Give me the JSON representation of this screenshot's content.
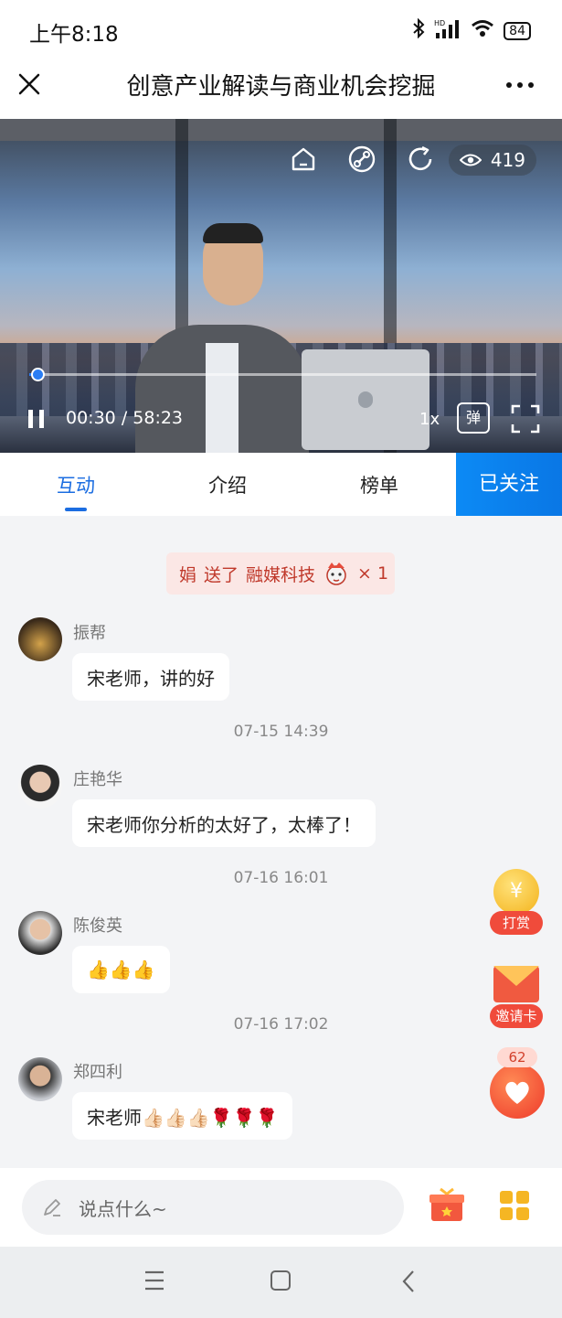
{
  "status_bar": {
    "time": "上午8:18",
    "signal": "HD",
    "battery": "84"
  },
  "header": {
    "title": "创意产业解读与商业机会挖掘"
  },
  "video": {
    "viewer_count": "419",
    "current_time": "00:30",
    "duration": "58:23",
    "time_separator": "/",
    "speed": "1x",
    "danmu_label": "弹",
    "progress_fraction": 0.009
  },
  "tabs": [
    {
      "label": "互动",
      "active": true
    },
    {
      "label": "介绍",
      "active": false
    },
    {
      "label": "榜单",
      "active": false
    }
  ],
  "follow_button": "已关注",
  "gift_banner": {
    "sender": "娟",
    "verb": "送了",
    "gift": "融媒科技",
    "count": "× 1"
  },
  "messages": [
    {
      "user": "振帮",
      "text": "宋老师，讲的好"
    },
    {
      "timestamp": "07-15 14:39"
    },
    {
      "user": "庄艳华",
      "text": "宋老师你分析的太好了，太棒了！"
    },
    {
      "timestamp": "07-16 16:01"
    },
    {
      "user": "陈俊英",
      "text": "👍👍👍"
    },
    {
      "timestamp": "07-16 17:02"
    },
    {
      "user": "郑四利",
      "text": "宋老师👍🏻👍🏻👍🏻🌹🌹🌹"
    }
  ],
  "floating": {
    "reward_label": "打赏",
    "invite_label": "邀请卡",
    "like_count": "62"
  },
  "input": {
    "placeholder": "说点什么~"
  },
  "colors": {
    "accent": "#1b6de1",
    "follow_bg": "#0a80ee",
    "gift_text": "#c0392b",
    "float_red": "#f04b3b"
  }
}
